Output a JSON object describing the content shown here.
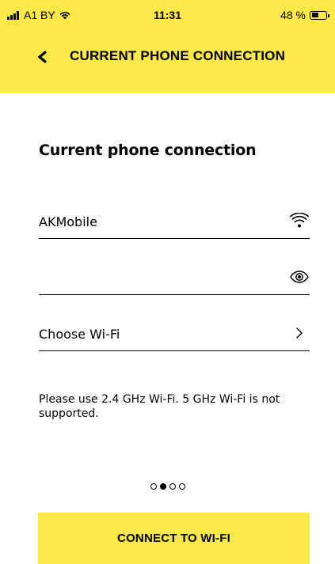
{
  "status_bar": {
    "carrier": "A1 BY",
    "time": "11:31",
    "battery": "48 %",
    "battery_level": 0.48,
    "signal_icon": "signal-bars-icon",
    "wifi_icon": "wifi-icon"
  },
  "nav": {
    "back_icon": "back-chevron-icon",
    "title": "CURRENT PHONE CONNECTION"
  },
  "main": {
    "heading": "Current phone connection",
    "network_field": {
      "value": "AKMobile",
      "icon": "wifi-icon"
    },
    "password_field": {
      "value": "",
      "placeholder": "",
      "icon": "eye-icon"
    },
    "choose_wifi": {
      "label": "Choose Wi-Fi",
      "icon": "chevron-right-icon"
    },
    "notice": "Please use 2.4 GHz Wi-Fi. 5 GHz Wi-Fi is not supported."
  },
  "pager": {
    "total": 4,
    "active_index": 1
  },
  "actions": {
    "connect_label": "CONNECT TO WI-FI"
  },
  "colors": {
    "accent": "#fbe94a",
    "text": "#000000",
    "background": "#ffffff"
  }
}
